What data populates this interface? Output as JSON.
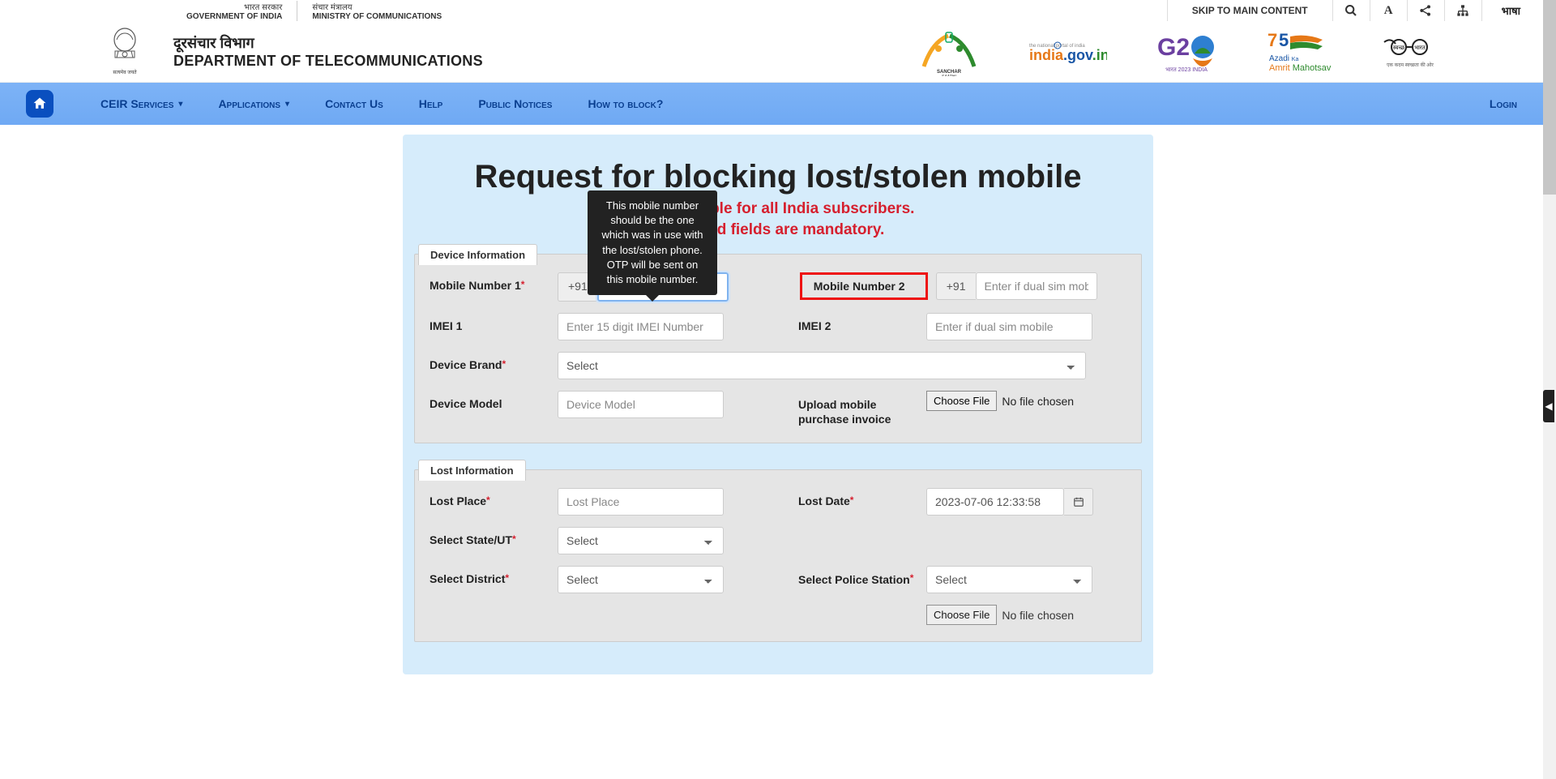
{
  "gov": {
    "hindi1": "भारत सरकार",
    "eng1": "GOVERNMENT OF INDIA",
    "hindi2": "संचार मंत्रालय",
    "eng2": "MINISTRY OF COMMUNICATIONS",
    "skip": "SKIP TO MAIN CONTENT",
    "lang": "भाषा"
  },
  "dept": {
    "hindi": "दूरसंचार विभाग",
    "eng": "DEPARTMENT OF TELECOMMUNICATIONS",
    "emblem_caption": "सत्यमेव जयते"
  },
  "logos": {
    "sanchar": "SANCHAR SAATHI",
    "indiagov": "india.gov.in",
    "indiagov_sub": "the national portal of india",
    "g20": "G20",
    "g20_sub": "भारत 2023 INDIA",
    "azadi1": "Azadi Ka",
    "azadi2": "Amrit Mahotsav",
    "swachh": "एक कदम स्वच्छता की ओर"
  },
  "nav": {
    "ceir": "CEIR Services",
    "apps": "Applications",
    "contact": "Contact Us",
    "help": "Help",
    "notices": "Public Notices",
    "howto": "How to block?",
    "login": "Login"
  },
  "form": {
    "title": "Request for blocking lost/stolen mobile",
    "sub1": "ow available for all India subscribers.",
    "sub2": "marked fields are mandatory.",
    "tooltip": "This mobile number should be the one which was in use with the lost/stolen phone. OTP will be sent on this mobile number."
  },
  "section1": {
    "tab": "Device Information",
    "mob1_label": "Mobile Number 1",
    "mob1_prefix": "+91",
    "mob1_ph": "Mobile Number 1",
    "mob2_label": "Mobile Number 2",
    "mob2_prefix": "+91",
    "mob2_ph": "Enter if dual sim mobile",
    "imei1_label": "IMEI 1",
    "imei1_ph": "Enter 15 digit IMEI Number",
    "imei2_label": "IMEI 2",
    "imei2_ph": "Enter if dual sim mobile",
    "brand_label": "Device Brand",
    "brand_sel": "Select",
    "model_label": "Device Model",
    "model_ph": "Device Model",
    "upload_label": "Upload mobile purchase invoice",
    "choose": "Choose File",
    "nofile": "No file chosen"
  },
  "section2": {
    "tab": "Lost Information",
    "place_label": "Lost Place",
    "place_ph": "Lost Place",
    "date_label": "Lost Date",
    "date_val": "2023-07-06 12:33:58",
    "state_label": "Select State/UT",
    "state_sel": "Select",
    "dist_label": "Select District",
    "dist_sel": "Select",
    "police_label": "Select Police Station",
    "police_sel": "Select",
    "choose": "Choose File",
    "nofile": "No file chosen"
  }
}
